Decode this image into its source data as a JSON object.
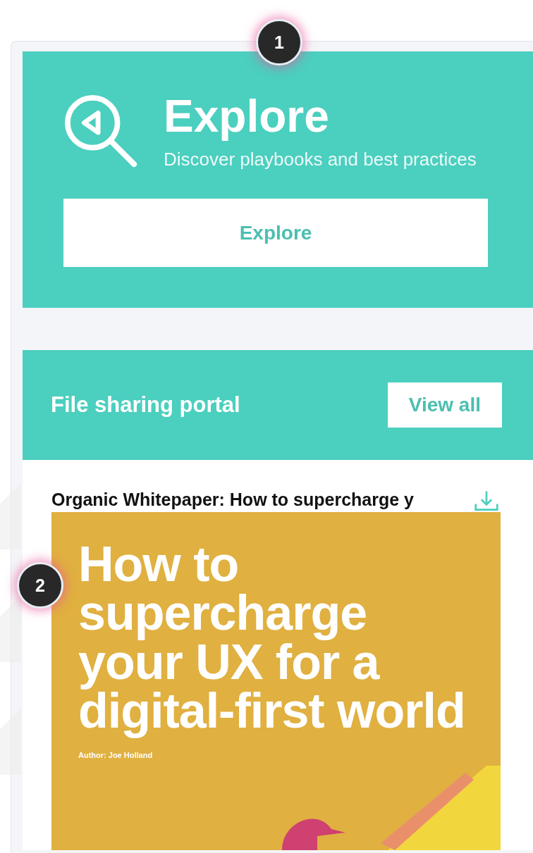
{
  "explore": {
    "title": "Explore",
    "subtitle": "Discover playbooks and best practices",
    "button": "Explore"
  },
  "file_portal": {
    "title": "File sharing portal",
    "view_all": "View all",
    "file": {
      "title": "Organic Whitepaper: How to supercharge y",
      "cover_headline": "How to supercharge your UX for a digital-first world",
      "cover_author": "Author: Joe Holland"
    }
  },
  "callouts": [
    "1",
    "2"
  ]
}
